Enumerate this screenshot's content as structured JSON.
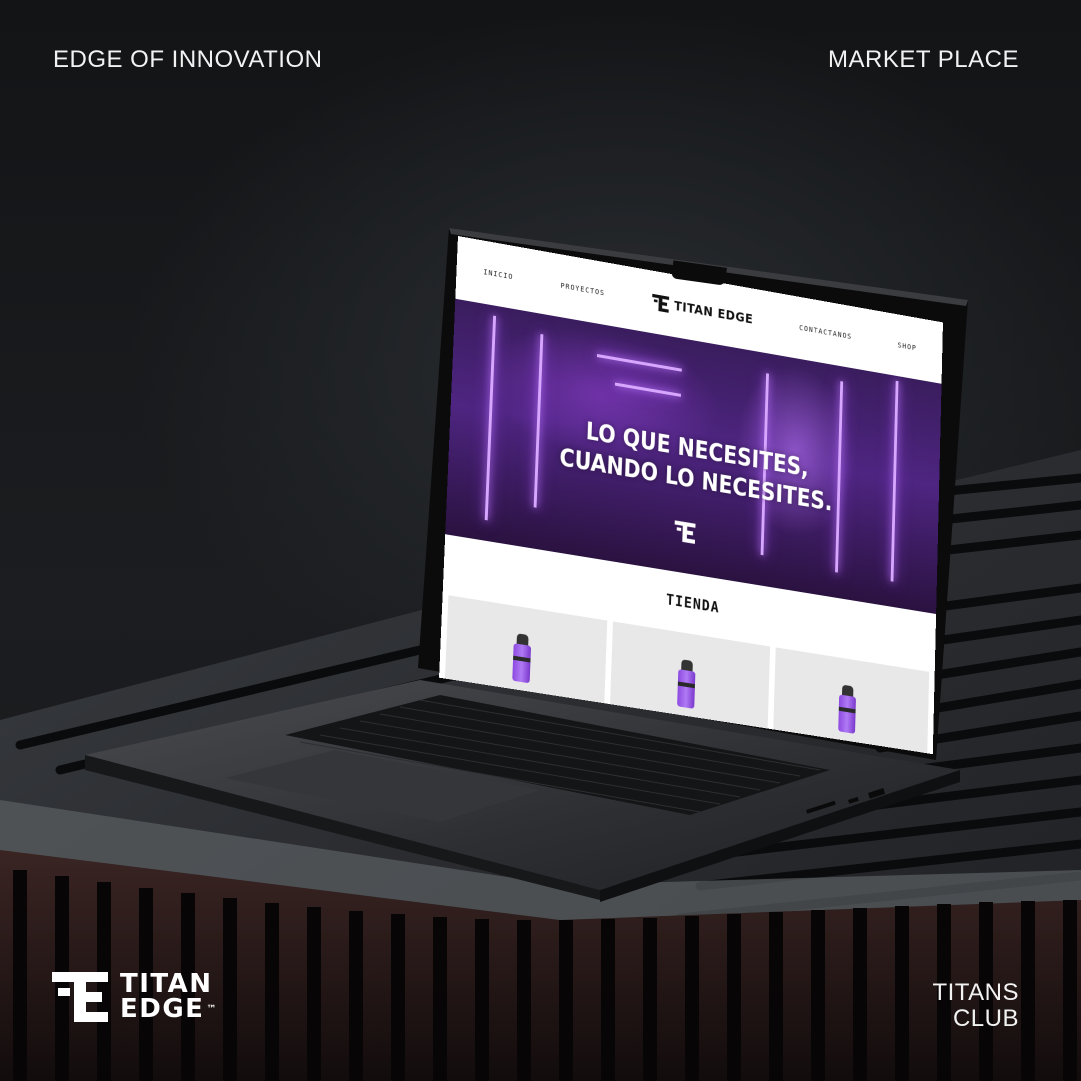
{
  "header": {
    "left_text": "EDGE OF INNOVATION",
    "right_text": "MARKET PLACE"
  },
  "footer": {
    "brand_line1": "TITAN",
    "brand_line2": "EDGE",
    "trademark": "™",
    "right_line1": "TITANS",
    "right_line2": "CLUB"
  },
  "website": {
    "nav": [
      "INICIO",
      "PROYECTOS",
      "CONTACTANOS",
      "SHOP"
    ],
    "logo_text": "TITAN EDGE",
    "hero_line1": "LO QUE NECESITES,",
    "hero_line2": "CUANDO LO NECESITES.",
    "shop_title": "TIENDA",
    "accent_color": "#8d4ae0"
  }
}
